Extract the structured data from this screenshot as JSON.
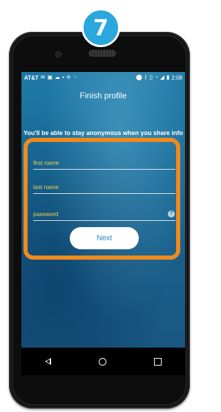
{
  "step": {
    "number": "7"
  },
  "status_bar": {
    "carrier": "AT&T",
    "icons": [
      "message-icon",
      "chat-icon",
      "cloud-icon",
      "image-icon",
      "usb-icon",
      "sync-icon",
      "location-icon",
      "bluetooth-icon",
      "vibrate-icon",
      "wifi-icon",
      "signal-icon",
      "battery-icon"
    ],
    "time": "2:08"
  },
  "screen": {
    "title": "Finish profile",
    "subtitle": "You'll be able to stay anonymous when you share info"
  },
  "form": {
    "first_name_placeholder": "first name",
    "last_name_placeholder": "last name",
    "password_placeholder": "password",
    "help_symbol": "?",
    "next_label": "Next"
  },
  "colors": {
    "accent_orange": "#f08a1c",
    "badge_blue": "#2aa7dc",
    "placeholder_yellow": "#f2d44a",
    "screen_blue": "#1b5a86"
  }
}
